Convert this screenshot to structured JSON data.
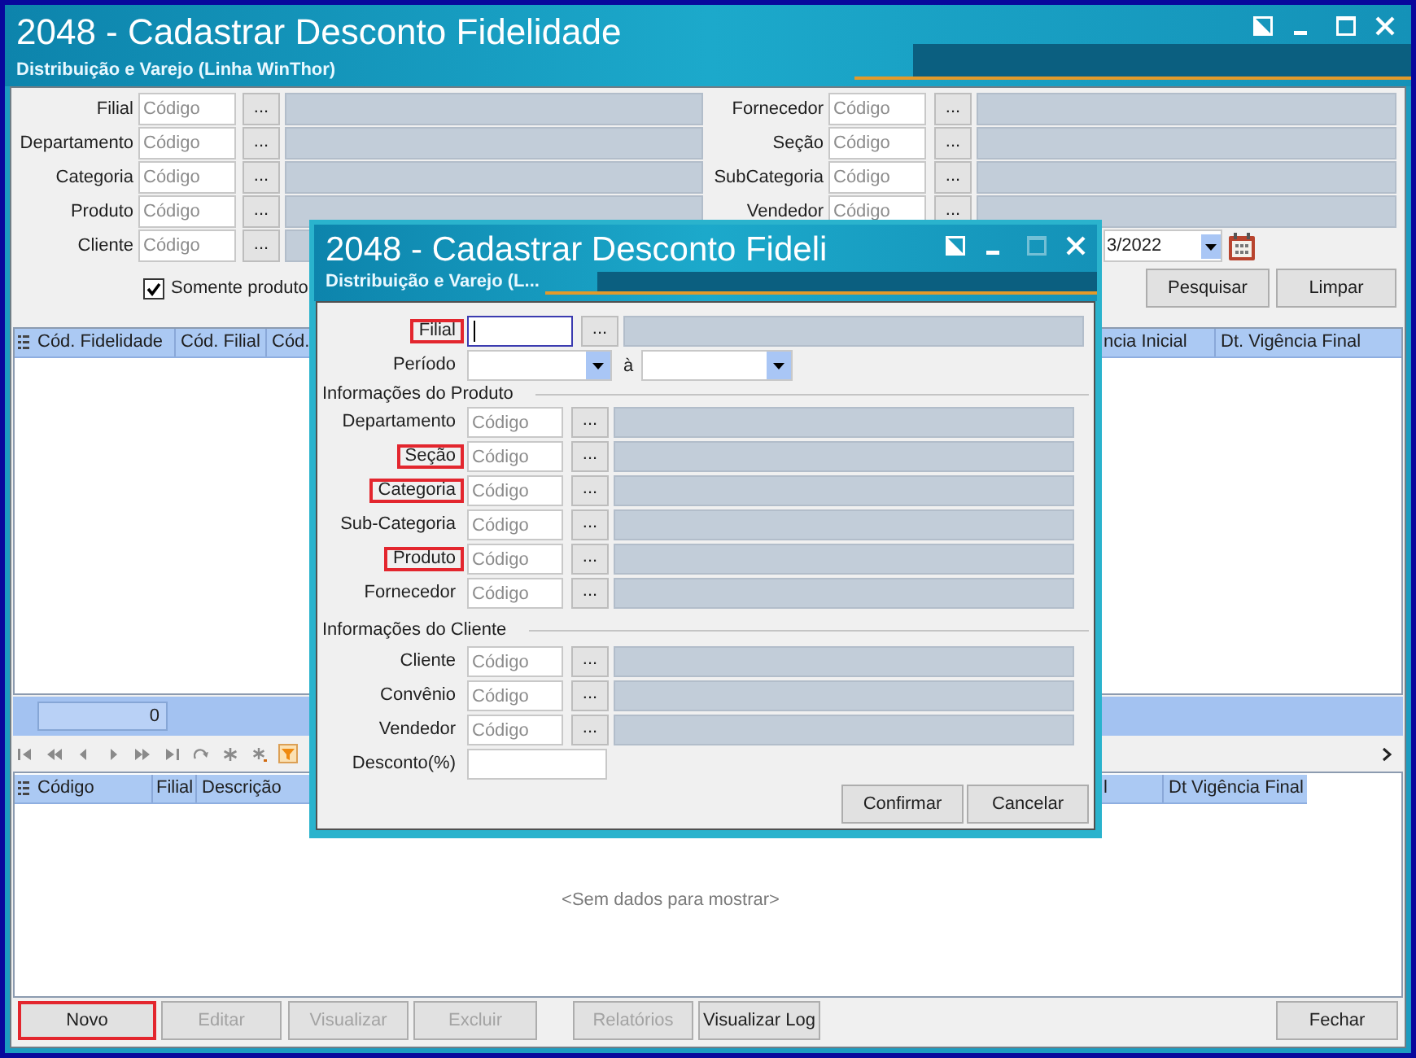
{
  "window": {
    "title": "2048 - Cadastrar Desconto Fidelidade",
    "subtitle": "Distribuição e Varejo (Linha WinThor)"
  },
  "filters": {
    "left": [
      {
        "label": "Filial",
        "placeholder": "Código",
        "browse": "..."
      },
      {
        "label": "Departamento",
        "placeholder": "Código",
        "browse": "..."
      },
      {
        "label": "Categoria",
        "placeholder": "Código",
        "browse": "..."
      },
      {
        "label": "Produto",
        "placeholder": "Código",
        "browse": "..."
      },
      {
        "label": "Cliente",
        "placeholder": "Código",
        "browse": "..."
      }
    ],
    "right": [
      {
        "label": "Fornecedor",
        "placeholder": "Código",
        "browse": "..."
      },
      {
        "label": "Seção",
        "placeholder": "Código",
        "browse": "..."
      },
      {
        "label": "SubCategoria",
        "placeholder": "Código",
        "browse": "..."
      },
      {
        "label": "Vendedor",
        "placeholder": "Código",
        "browse": "..."
      }
    ],
    "period_end": {
      "value": "3/2022"
    }
  },
  "only_products": {
    "label": "Somente produto",
    "checked": true
  },
  "filter_buttons": [
    "Pesquisar",
    "Limpar"
  ],
  "loyalty_grid": {
    "columns_left": [
      "Cód. Fidelidade",
      "Cód. Filial",
      "Cód."
    ],
    "columns_right": [
      "ncia Inicial",
      "Dt. Vigência Final"
    ],
    "total": "0"
  },
  "items_grid": {
    "columns_left": [
      "Código",
      "Filial",
      "Descrição"
    ],
    "columns_right": [
      "l",
      "Dt Vigência Final"
    ],
    "empty_text": "<Sem dados para mostrar>"
  },
  "toolbar": [
    {
      "buttons": [
        {
          "label": "Novo",
          "disabled": false,
          "highlighted": true
        },
        {
          "label": "Editar",
          "disabled": true,
          "highlighted": false
        },
        {
          "label": "Visualizar",
          "disabled": true,
          "highlighted": false
        },
        {
          "label": "Excluir",
          "disabled": true,
          "highlighted": false
        }
      ]
    },
    {
      "buttons": [
        {
          "label": "Relatórios",
          "disabled": true,
          "highlighted": false
        },
        {
          "label": "Visualizar Log",
          "disabled": false,
          "highlighted": false
        }
      ]
    },
    {
      "buttons": [
        {
          "label": "Fechar",
          "disabled": false,
          "highlighted": false
        }
      ]
    }
  ],
  "dialog": {
    "title": "2048 - Cadastrar Desconto Fideli",
    "subtitle": "Distribuição e Varejo (L...",
    "maximize_disabled": true,
    "branch": {
      "label": "Filial",
      "highlighted": true,
      "focused": true,
      "browse": "..."
    },
    "period": {
      "label": "Período",
      "separator": "à"
    },
    "sections": [
      {
        "title": "Informações do Produto",
        "fields": [
          {
            "label": "Departamento",
            "placeholder": "Código",
            "browse": "...",
            "highlighted": false
          },
          {
            "label": "Seção",
            "placeholder": "Código",
            "browse": "...",
            "highlighted": true
          },
          {
            "label": "Categoria",
            "placeholder": "Código",
            "browse": "...",
            "highlighted": true
          },
          {
            "label": "Sub-Categoria",
            "placeholder": "Código",
            "browse": "...",
            "highlighted": false
          },
          {
            "label": "Produto",
            "placeholder": "Código",
            "browse": "...",
            "highlighted": true
          },
          {
            "label": "Fornecedor",
            "placeholder": "Código",
            "browse": "...",
            "highlighted": false
          }
        ]
      },
      {
        "title": "Informações do Cliente",
        "fields": [
          {
            "label": "Cliente",
            "placeholder": "Código",
            "browse": "...",
            "highlighted": false
          },
          {
            "label": "Convênio",
            "placeholder": "Código",
            "browse": "...",
            "highlighted": false
          },
          {
            "label": "Vendedor",
            "placeholder": "Código",
            "browse": "...",
            "highlighted": false
          }
        ]
      }
    ],
    "discount": {
      "label": "Desconto(%)"
    },
    "buttons": [
      "Confirmar",
      "Cancelar"
    ]
  }
}
